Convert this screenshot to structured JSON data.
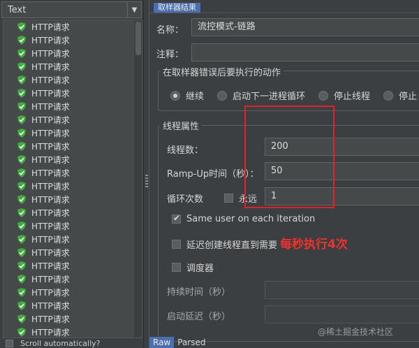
{
  "left": {
    "view_select": "Text",
    "tree_items": [
      "HTTP请求",
      "HTTP请求",
      "HTTP请求",
      "HTTP请求",
      "HTTP请求",
      "HTTP请求",
      "HTTP请求",
      "HTTP请求",
      "HTTP请求",
      "HTTP请求",
      "HTTP请求",
      "HTTP请求",
      "HTTP请求",
      "HTTP请求",
      "HTTP请求",
      "HTTP请求",
      "HTTP请求",
      "HTTP请求",
      "HTTP请求",
      "HTTP请求",
      "HTTP请求",
      "HTTP请求",
      "HTTP请求",
      "HTTP请求"
    ],
    "scroll_auto_label": "Scroll automatically?"
  },
  "right": {
    "top_tab": "取样器结果",
    "name_label": "名称：",
    "name_value": "流控模式-链路",
    "comment_label": "注释：",
    "comment_value": "",
    "error_group_title": "在取样器错误后要执行的动作",
    "error_actions": [
      {
        "label": "继续",
        "selected": true
      },
      {
        "label": "启动下一进程循环",
        "selected": false
      },
      {
        "label": "停止线程",
        "selected": false
      },
      {
        "label": "停止",
        "selected": false
      }
    ],
    "thread_group_title": "线程属性",
    "threads_label": "线程数：",
    "threads_value": "200",
    "rampup_label": "Ramp-Up时间（秒）：",
    "rampup_value": "50",
    "loop_label": "循环次数",
    "forever_label": "永远",
    "forever_checked": false,
    "loop_value": "1",
    "same_user_label": "Same user on each iteration",
    "same_user_checked": true,
    "delay_create_label": "延迟创建线程直到需要",
    "delay_create_checked": false,
    "scheduler_label": "调度器",
    "scheduler_checked": false,
    "duration_label": "持续时间（秒）",
    "startup_delay_label": "启动延迟（秒）",
    "annotation": "每秒执行4次",
    "bottom_tabs": [
      "Raw",
      "Parsed"
    ],
    "watermark": "@稀土掘金技术社区"
  },
  "colors": {
    "background": "#3c3f41",
    "accent": "#4b6eaf",
    "annotation_red": "#e0232b",
    "shield_green": "#3fae3f"
  }
}
